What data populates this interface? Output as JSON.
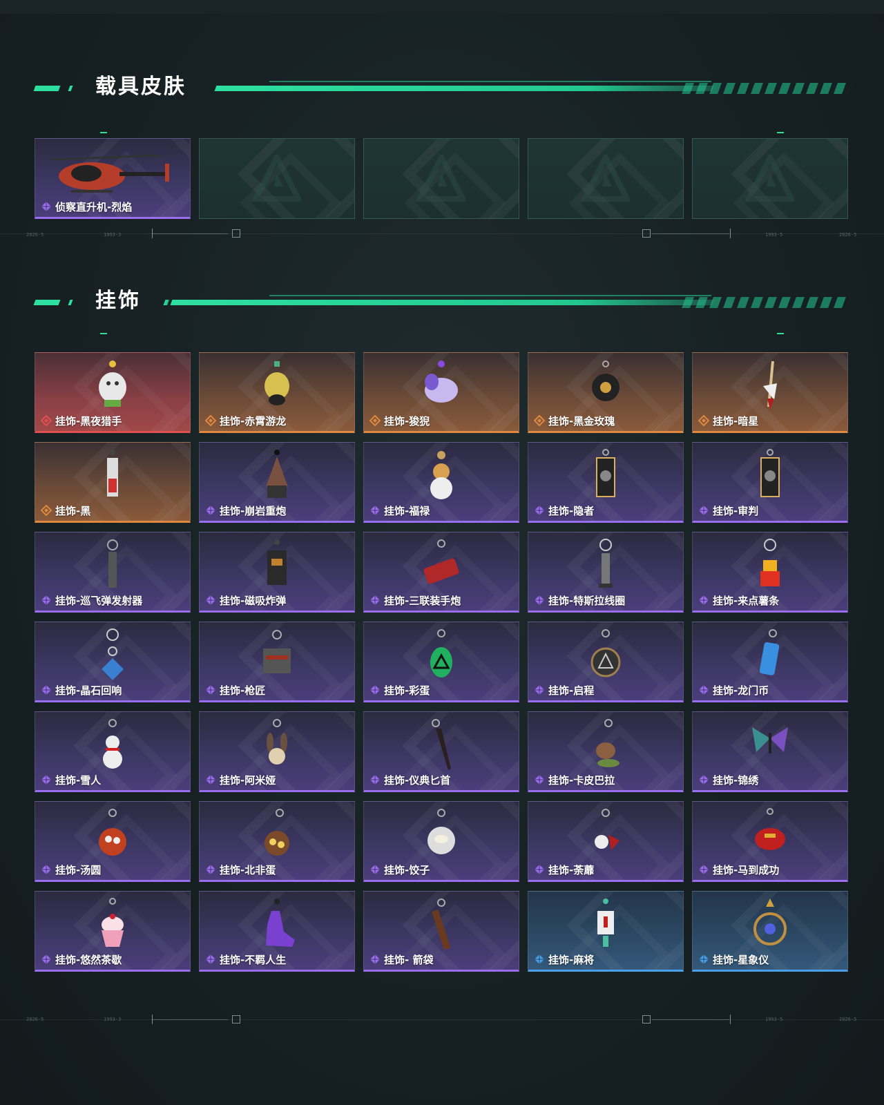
{
  "sections": {
    "vehicle": {
      "title": "载具皮肤",
      "items": [
        {
          "name": "侦察直升机-烈焰",
          "rarity": "purple",
          "icon": "helicopter-icon"
        },
        {
          "name": "",
          "rarity": "empty",
          "icon": "logo-placeholder-icon"
        },
        {
          "name": "",
          "rarity": "empty",
          "icon": "logo-placeholder-icon"
        },
        {
          "name": "",
          "rarity": "empty",
          "icon": "logo-placeholder-icon"
        },
        {
          "name": "",
          "rarity": "empty",
          "icon": "logo-placeholder-icon"
        }
      ]
    },
    "charms": {
      "title": "挂饰",
      "items": [
        {
          "name": "挂饰-黑夜猎手",
          "rarity": "red",
          "icon": "white-beast-charm-icon"
        },
        {
          "name": "挂饰-赤霄游龙",
          "rarity": "orange",
          "icon": "dragon-charm-icon"
        },
        {
          "name": "挂饰-狻猊",
          "rarity": "orange",
          "icon": "lion-charm-icon"
        },
        {
          "name": "挂饰-黑金玫瑰",
          "rarity": "orange",
          "icon": "rose-charm-icon"
        },
        {
          "name": "挂饰-暗星",
          "rarity": "orange",
          "icon": "star-charm-icon"
        },
        {
          "name": "挂饰-黑",
          "rarity": "orange",
          "icon": "tag-charm-icon"
        },
        {
          "name": "挂饰-崩岩重炮",
          "rarity": "purple",
          "icon": "figure-charm-icon"
        },
        {
          "name": "挂饰-福禄",
          "rarity": "purple",
          "icon": "gourd-charm-icon"
        },
        {
          "name": "挂饰-隐者",
          "rarity": "purple",
          "icon": "card-charm-icon"
        },
        {
          "name": "挂饰-审判",
          "rarity": "purple",
          "icon": "card-charm-icon"
        },
        {
          "name": "挂饰-巡飞弹发射器",
          "rarity": "purple",
          "icon": "launcher-charm-icon"
        },
        {
          "name": "挂饰-磁吸炸弹",
          "rarity": "purple",
          "icon": "bomb-charm-icon"
        },
        {
          "name": "挂饰-三联装手炮",
          "rarity": "purple",
          "icon": "cannon-charm-icon"
        },
        {
          "name": "挂饰-特斯拉线圈",
          "rarity": "purple",
          "icon": "coil-charm-icon"
        },
        {
          "name": "挂饰-来点薯条",
          "rarity": "purple",
          "icon": "fries-charm-icon"
        },
        {
          "name": "挂饰-晶石回响",
          "rarity": "purple",
          "icon": "crystal-charm-icon"
        },
        {
          "name": "挂饰-枪匠",
          "rarity": "purple",
          "icon": "toolbox-charm-icon"
        },
        {
          "name": "挂饰-彩蛋",
          "rarity": "purple",
          "icon": "egg-charm-icon"
        },
        {
          "name": "挂饰-启程",
          "rarity": "purple",
          "icon": "badge-charm-icon"
        },
        {
          "name": "挂饰-龙门币",
          "rarity": "purple",
          "icon": "coin-charm-icon"
        },
        {
          "name": "挂饰-雪人",
          "rarity": "purple",
          "icon": "snowman-charm-icon"
        },
        {
          "name": "挂饰-阿米娅",
          "rarity": "purple",
          "icon": "rabbit-charm-icon"
        },
        {
          "name": "挂饰-仪典匕首",
          "rarity": "purple",
          "icon": "dagger-charm-icon"
        },
        {
          "name": "挂饰-卡皮巴拉",
          "rarity": "purple",
          "icon": "capybara-charm-icon"
        },
        {
          "name": "挂饰-锦绣",
          "rarity": "purple",
          "icon": "butterfly-charm-icon"
        },
        {
          "name": "挂饰-汤圆",
          "rarity": "purple",
          "icon": "dumpling-bowl-charm-icon"
        },
        {
          "name": "挂饰-北非蛋",
          "rarity": "purple",
          "icon": "pan-charm-icon"
        },
        {
          "name": "挂饰-饺子",
          "rarity": "purple",
          "icon": "plate-charm-icon"
        },
        {
          "name": "挂饰-荼蘼",
          "rarity": "purple",
          "icon": "flower-charm-icon"
        },
        {
          "name": "挂饰-马到成功",
          "rarity": "purple",
          "icon": "horse-charm-icon"
        },
        {
          "name": "挂饰-悠然茶歇",
          "rarity": "purple",
          "icon": "cupcake-charm-icon"
        },
        {
          "name": "挂饰-不羁人生",
          "rarity": "purple",
          "icon": "sneaker-charm-icon"
        },
        {
          "name": "挂饰- 箭袋",
          "rarity": "purple",
          "icon": "quiver-charm-icon"
        },
        {
          "name": "挂饰-麻将",
          "rarity": "blue",
          "icon": "mahjong-charm-icon"
        },
        {
          "name": "挂饰-星象仪",
          "rarity": "blue",
          "icon": "astrolabe-charm-icon"
        }
      ]
    }
  },
  "colors": {
    "accent": "#2ee0a0",
    "red": "#e05050",
    "orange": "#e08840",
    "purple": "#9b6ef0",
    "blue": "#4aa0e8"
  },
  "deco_labels": [
    "2026-5",
    "1993-3",
    "1993-5",
    "2026-5"
  ]
}
